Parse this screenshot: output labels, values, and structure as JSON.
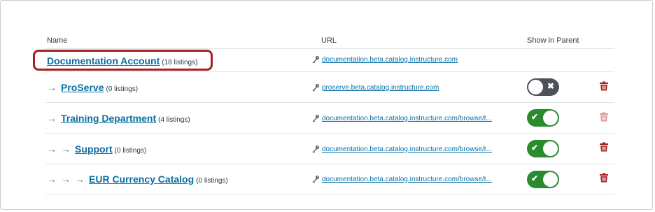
{
  "table": {
    "headers": {
      "name": "Name",
      "url": "URL",
      "show_in_parent": "Show in Parent"
    },
    "rows": [
      {
        "name": "Documentation Account",
        "count": "(18 listings)",
        "url": "documentation.beta.catalog.instructure.com",
        "show_in_parent": null,
        "highlighted": true
      },
      {
        "name": "ProServe",
        "count": "(0 listings)",
        "url": "proserve.beta.catalog.instructure.com",
        "show_in_parent": false
      },
      {
        "name": "Training Department",
        "count": "(4 listings)",
        "url": "documentation.beta.catalog.instructure.com/browse/t...",
        "show_in_parent": true
      },
      {
        "name": "Support",
        "count": "(0 listings)",
        "url": "documentation.beta.catalog.instructure.com/browse/t...",
        "show_in_parent": true
      },
      {
        "name": "EUR Currency Catalog",
        "count": "(0 listings)",
        "url": "documentation.beta.catalog.instructure.com/browse/t...",
        "show_in_parent": true
      }
    ]
  },
  "icons": {
    "arrow": "→",
    "toggle_on": "✔",
    "toggle_off": "✖"
  },
  "colors": {
    "link": "#0770a3",
    "highlight": "#a32122",
    "toggle_on": "#2a8a2e",
    "toggle_off": "#4c5257",
    "trash": "#a32122",
    "trash_disabled": "#d99a9a"
  }
}
